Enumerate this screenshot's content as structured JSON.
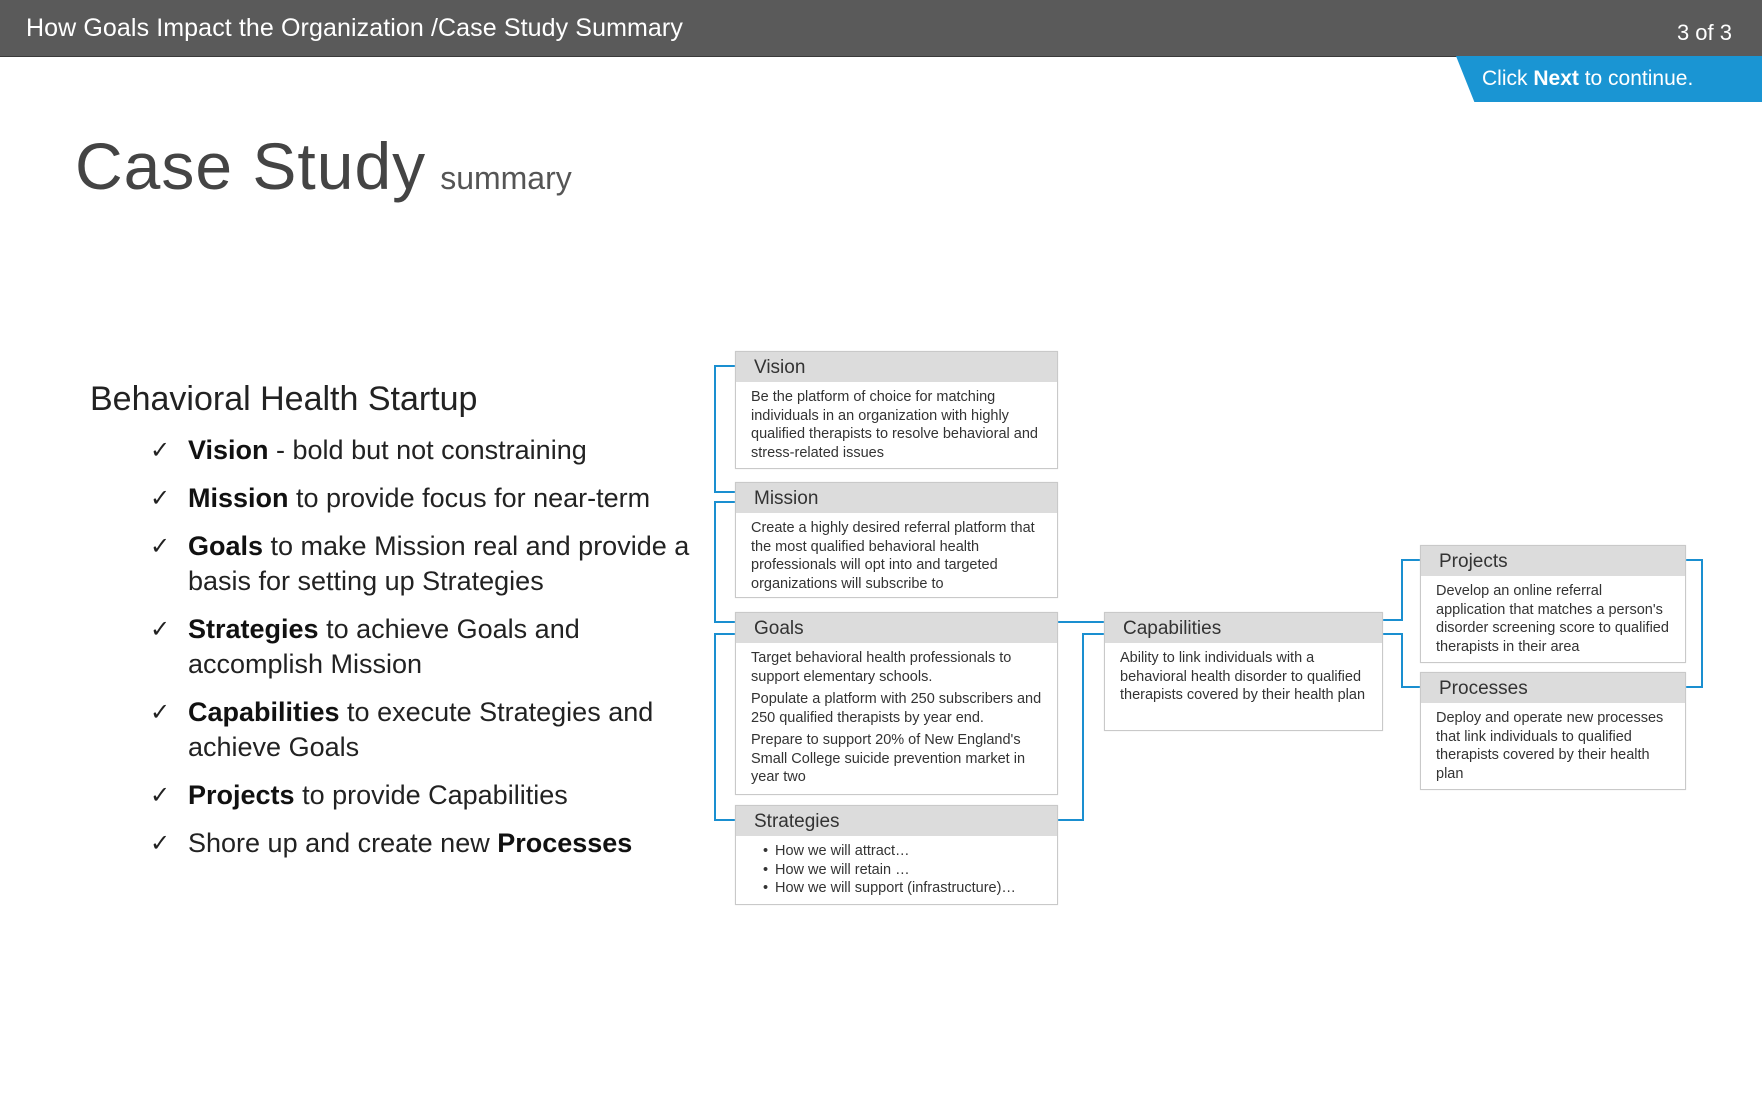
{
  "header": {
    "breadcrumb": "How Goals Impact the Organization /Case Study Summary",
    "pager": "3 of 3"
  },
  "next_banner": {
    "prefix": "Click ",
    "keyword": "Next",
    "suffix": " to continue."
  },
  "heading": {
    "title": "Case Study",
    "subtitle": "summary"
  },
  "left": {
    "org": "Behavioral Health Startup",
    "check_glyph": "✓",
    "items": [
      {
        "kw": "Vision",
        "rest": " - bold but not constraining"
      },
      {
        "kw": "Mission",
        "rest": " to provide focus for near-term"
      },
      {
        "kw": "Goals",
        "rest": " to make Mission real and provide a basis for setting up Strategies"
      },
      {
        "kw": "Strategies",
        "rest": " to achieve Goals and accomplish Mission"
      },
      {
        "kw": "Capabilities",
        "rest": " to execute Strategies and achieve Goals"
      },
      {
        "kw": "Projects",
        "rest": " to provide Capabilities"
      },
      {
        "pre": "Shore up and create new ",
        "kw": "Processes"
      }
    ]
  },
  "diagram": {
    "vision": {
      "title": "Vision",
      "text": "Be the platform of choice for matching individuals in an organization with highly qualified therapists to resolve behavioral and stress-related issues"
    },
    "mission": {
      "title": "Mission",
      "text": "Create a highly desired referral platform that the most qualified behavioral health professionals will opt into and targeted organizations will subscribe to"
    },
    "goals": {
      "title": "Goals",
      "items": [
        "Target behavioral health professionals to support elementary schools.",
        "Populate a platform with 250 subscribers and 250 qualified therapists by year end.",
        "Prepare to support 20% of New England's Small College suicide prevention market in year two"
      ]
    },
    "strategies": {
      "title": "Strategies",
      "items": [
        "How we will attract…",
        "How we will retain …",
        "How we will support (infrastructure)…"
      ]
    },
    "capabilities": {
      "title": "Capabilities",
      "text": "Ability to link individuals with a behavioral health disorder to qualified therapists covered by their health plan"
    },
    "projects": {
      "title": "Projects",
      "text": "Develop an online referral application that matches a person's disorder screening score to qualified therapists in their area"
    },
    "processes": {
      "title": "Processes",
      "text": "Deploy and operate new processes that link individuals to qualified therapists covered by their health plan"
    },
    "connector_color": "#1a8fd0"
  }
}
